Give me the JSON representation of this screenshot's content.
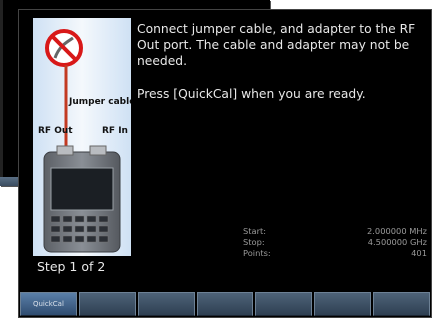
{
  "instructions": {
    "line1": "Connect jumper cable, and adapter to the RF Out port.  The cable and adapter may not be needed.",
    "line2": "Press [QuickCal] when you are ready."
  },
  "illustration": {
    "jumper_label": "Jumper cable",
    "rf_out_label": "RF Out",
    "rf_in_label": "RF In"
  },
  "step": "Step 1 of 2",
  "params": {
    "start_label": "Start:",
    "start_value": "2.000000 MHz",
    "stop_label": "Stop:",
    "stop_value": "4.500000 GHz",
    "points_label": "Points:",
    "points_value": "401"
  },
  "softkeys": [
    "QuickCal",
    "",
    "",
    "",
    "",
    "",
    ""
  ]
}
